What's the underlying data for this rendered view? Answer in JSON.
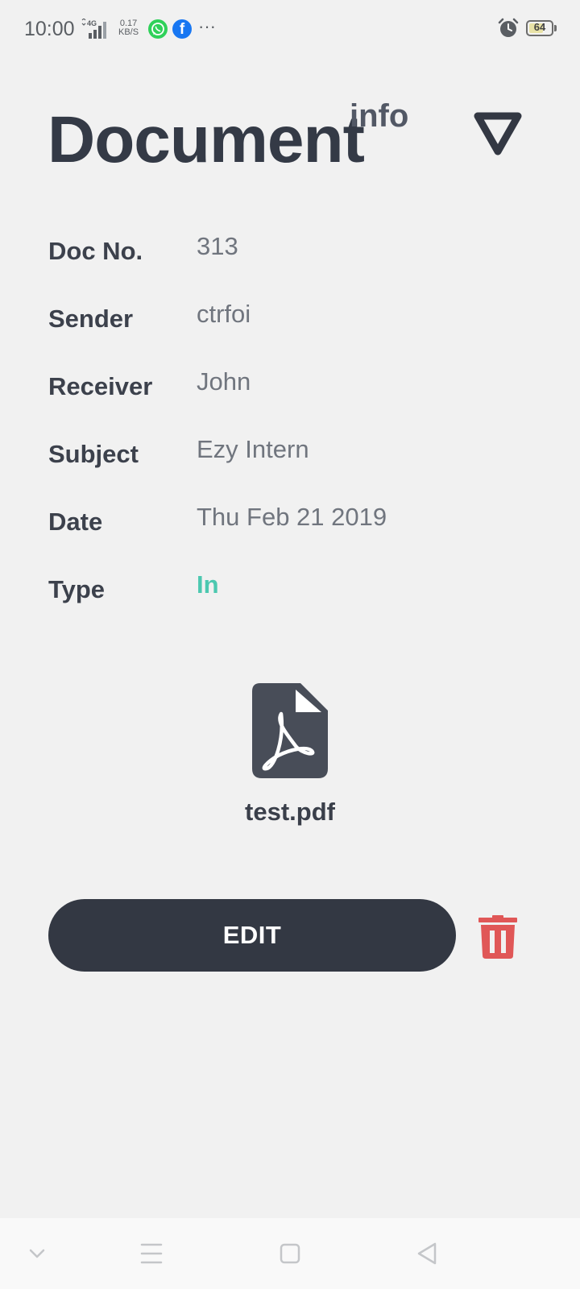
{
  "status_bar": {
    "time": "10:00",
    "network": "4G",
    "speed_value": "0.17",
    "speed_unit": "KB/S",
    "more": "···",
    "battery": "64",
    "battery_level": 0.64
  },
  "header": {
    "title": "Document",
    "title_sup": "info"
  },
  "details": [
    {
      "label": "Doc No.",
      "value": "313"
    },
    {
      "label": "Sender",
      "value": "ctrfoi"
    },
    {
      "label": "Receiver",
      "value": "John"
    },
    {
      "label": "Subject",
      "value": "Ezy Intern"
    },
    {
      "label": "Date",
      "value": "Thu Feb 21 2019"
    },
    {
      "label": "Type",
      "value": "In"
    }
  ],
  "attachment": {
    "icon": "pdf-icon",
    "file_name": "test.pdf"
  },
  "actions": {
    "edit_label": "EDIT",
    "delete_icon": "trash-icon"
  },
  "colors": {
    "primary": "#333843",
    "accent": "#4cc8b0",
    "danger": "#e05757",
    "background": "#f1f1f1"
  }
}
